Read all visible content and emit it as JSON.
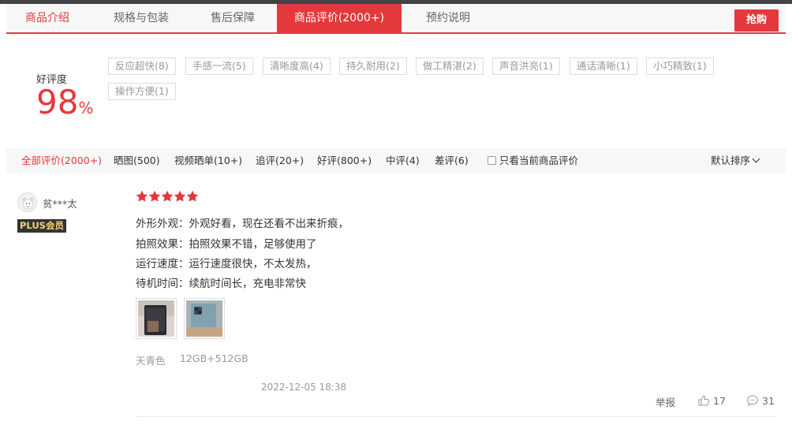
{
  "tabs": [
    {
      "label": "商品介绍"
    },
    {
      "label": "规格与包装"
    },
    {
      "label": "售后保障"
    },
    {
      "label": "商品评价(2000+)"
    },
    {
      "label": "预约说明"
    }
  ],
  "buy_label": "抢购",
  "summary": {
    "rate_label": "好评度",
    "rate_value": "98",
    "rate_unit": "%"
  },
  "tags": [
    "反应超快(8)",
    "手感一流(5)",
    "清晰度高(4)",
    "持久耐用(2)",
    "做工精湛(2)",
    "声音洪亮(1)",
    "通话清晰(1)",
    "小巧精致(1)",
    "操作方便(1)"
  ],
  "filters": [
    "全部评价(2000+)",
    "晒图(500)",
    "视频晒单(10+)",
    "追评(20+)",
    "好评(800+)",
    "中评(4)",
    "差评(6)"
  ],
  "only_current_label": "只看当前商品评价",
  "sort_label": "默认排序",
  "review": {
    "username": "贫***太",
    "badge": "PLUS会员",
    "rating": 5,
    "lines": [
      "外形外观：外观好看，现在还看不出来折痕，",
      "拍照效果：拍照效果不错，足够使用了",
      "运行速度：运行速度很快，不太发热，",
      "待机时间：续航时间长，充电非常快"
    ],
    "color": "天青色",
    "config": "12GB+512GB",
    "date": "2022-12-05 18:38",
    "report_label": "举报",
    "likes": "17",
    "comments": "31"
  },
  "colors": {
    "accent": "#e4393c"
  }
}
